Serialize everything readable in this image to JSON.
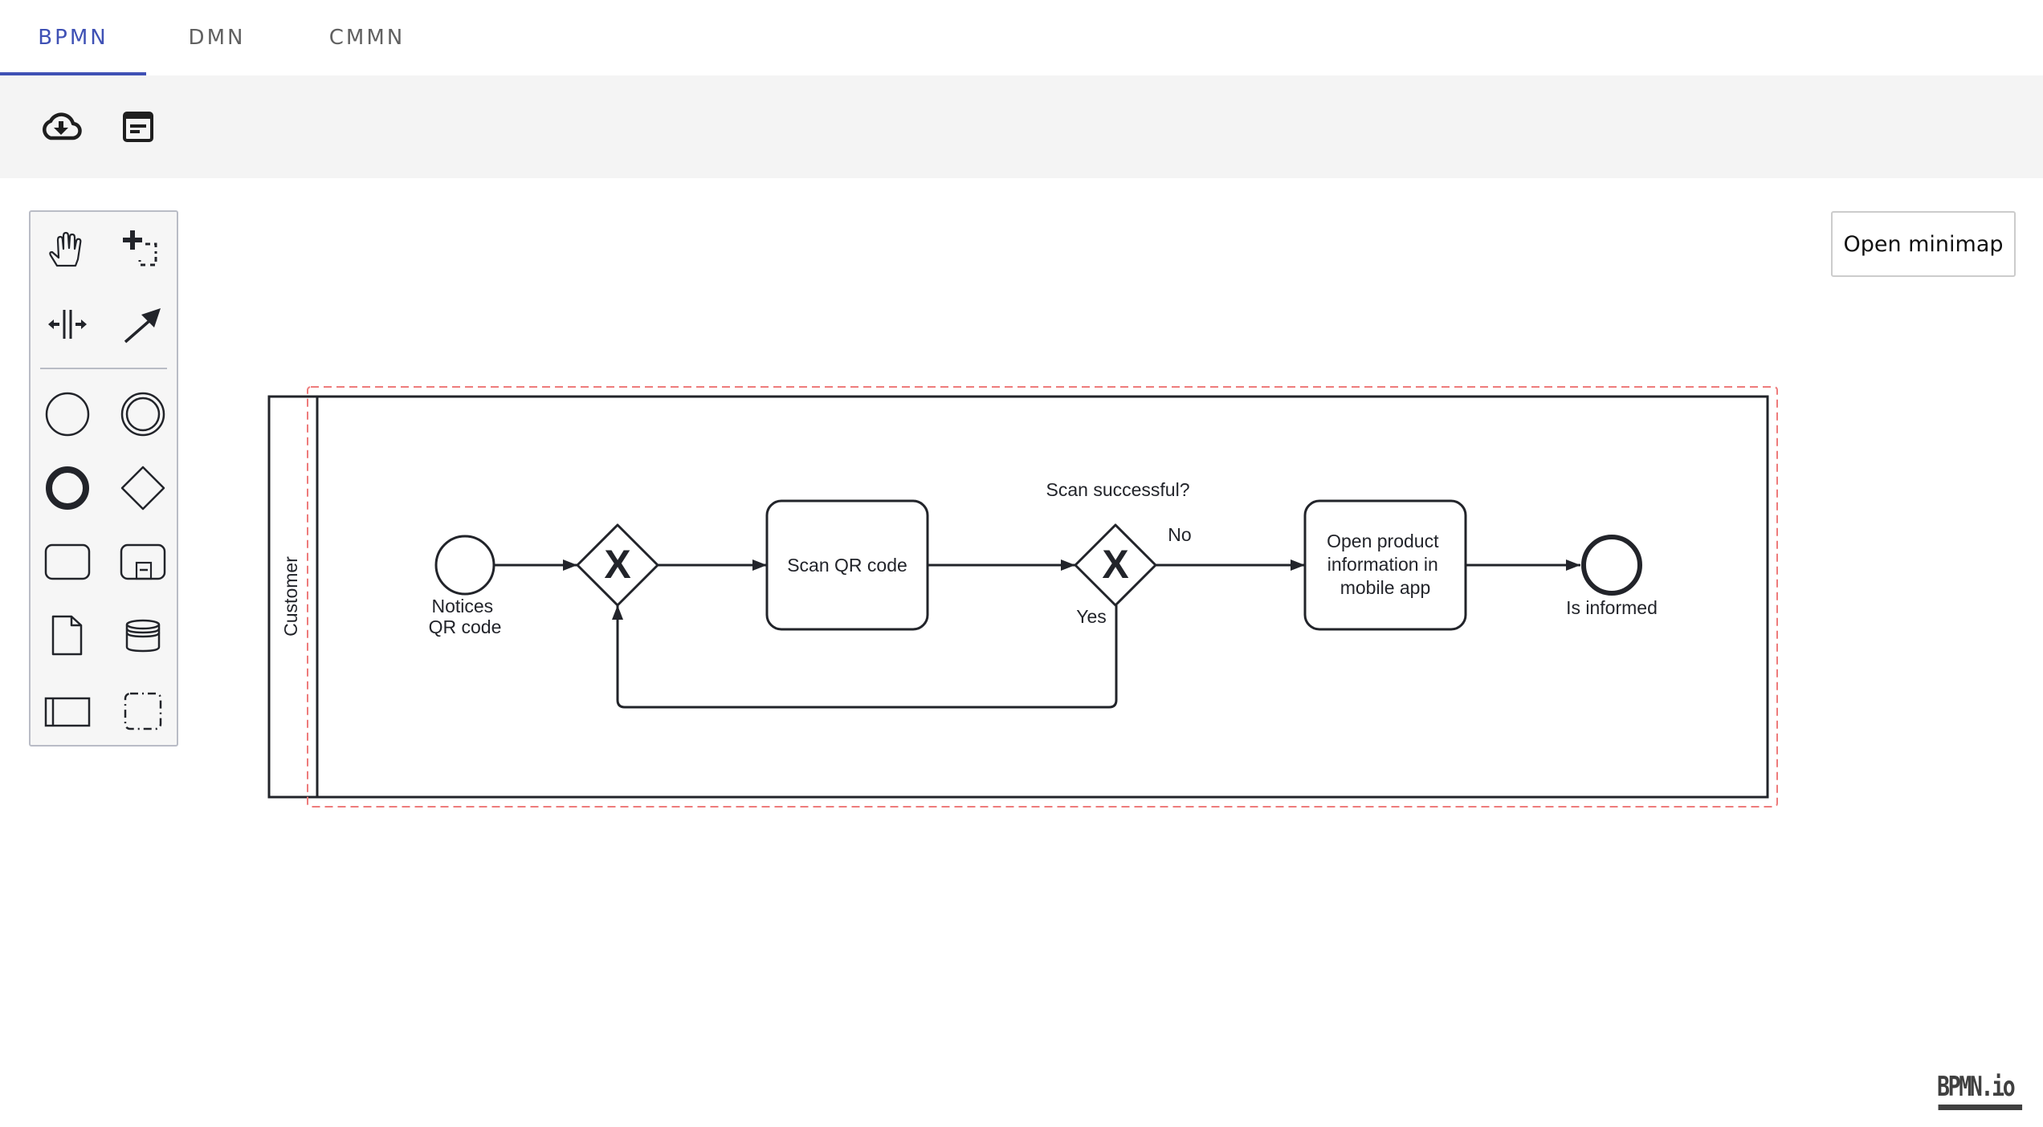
{
  "tabs": [
    {
      "label": "BPMN",
      "active": true
    },
    {
      "label": "DMN",
      "active": false
    },
    {
      "label": "CMMN",
      "active": false
    }
  ],
  "toolbar": {
    "buttons": [
      {
        "icon": "cloud-download-icon",
        "name": "download-button"
      },
      {
        "icon": "notes-icon",
        "name": "properties-button"
      }
    ]
  },
  "palette": {
    "tools": [
      {
        "icon": "hand-tool-icon",
        "name": "hand-tool"
      },
      {
        "icon": "lasso-tool-icon",
        "name": "lasso-tool"
      },
      {
        "icon": "space-tool-icon",
        "name": "space-tool"
      },
      {
        "icon": "global-connect-tool-icon",
        "name": "global-connect-tool"
      }
    ],
    "shapes": [
      {
        "icon": "start-event-icon",
        "name": "create-start-event"
      },
      {
        "icon": "intermediate-event-icon",
        "name": "create-intermediate-event"
      },
      {
        "icon": "end-event-icon",
        "name": "create-end-event"
      },
      {
        "icon": "gateway-icon",
        "name": "create-gateway"
      },
      {
        "icon": "task-icon",
        "name": "create-task"
      },
      {
        "icon": "subprocess-icon",
        "name": "create-subprocess"
      },
      {
        "icon": "data-object-icon",
        "name": "create-data-object"
      },
      {
        "icon": "data-store-icon",
        "name": "create-data-store"
      },
      {
        "icon": "participant-icon",
        "name": "create-pool"
      },
      {
        "icon": "group-icon",
        "name": "create-group"
      }
    ]
  },
  "minimap": {
    "label": "Open minimap"
  },
  "diagram": {
    "pool": {
      "label": "Customer",
      "selected": true
    },
    "start_event": {
      "label_lines": [
        "Notices",
        "QR code"
      ]
    },
    "gateway_merge": {
      "marker": "X"
    },
    "task_scan": {
      "label_lines": [
        "Scan QR code"
      ]
    },
    "gateway_decision": {
      "label": "Scan successful?",
      "marker": "X"
    },
    "flow_no": {
      "label": "No"
    },
    "flow_yes": {
      "label": "Yes"
    },
    "task_open": {
      "label_lines": [
        "Open product",
        "information in",
        "mobile app"
      ]
    },
    "end_event": {
      "label": "Is informed"
    },
    "colors": {
      "stroke": "#22242a",
      "selection": "#ee7b7b",
      "accent": "#3f51b5"
    }
  },
  "watermark": {
    "label": "BPMN.io"
  }
}
